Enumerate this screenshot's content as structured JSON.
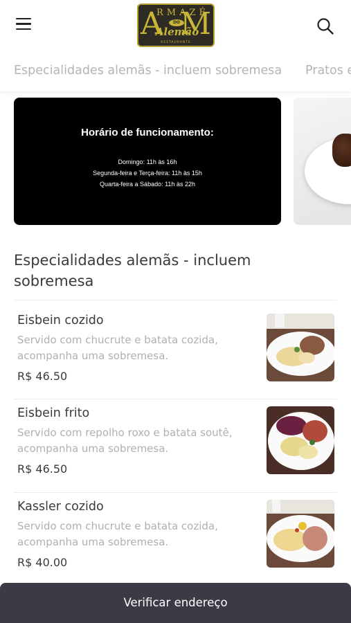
{
  "header": {
    "logo": {
      "letter_left": "A",
      "letters_top": "RMAZÉ",
      "letter_right": "M",
      "do_text": "DO",
      "script": "Alemão",
      "subtitle": "RESTAURANTE"
    }
  },
  "tabs": [
    {
      "label": "Especialidades alemãs - incluem sobremesa"
    },
    {
      "label": "Pratos e"
    }
  ],
  "banner": {
    "title": "Horário de funcionamento:",
    "lines": [
      "Domingo: 11h às 16h",
      "Segunda-feira e Terça-feira: 11h às 15h",
      "Quarta-feira a Sábado: 11h às 22h"
    ]
  },
  "section": {
    "title": "Especialidades alemãs - incluem sobremesa"
  },
  "items": [
    {
      "name": "Eisbein cozido",
      "description": "Servido com chucrute e batata cozida, acompanha uma sobremesa.",
      "price": "R$ 46.50"
    },
    {
      "name": "Eisbein frito",
      "description": "Servido com repolho roxo e batata soutê, acompanha uma sobremesa.",
      "price": "R$ 46.50"
    },
    {
      "name": "Kassler cozido",
      "description": "Servido com chucrute e batata cozida, acompanha uma sobremesa.",
      "price": "R$ 40.00"
    }
  ],
  "bottom_bar": {
    "label": "Verificar endereço"
  },
  "icons": {
    "menu": "hamburger-menu-icon",
    "search": "search-icon"
  },
  "colors": {
    "bottom_bar": "#3c3b45",
    "logo_gold": "#c9b537",
    "logo_bg": "#2e2b25",
    "muted_text": "#b0b0b0"
  }
}
